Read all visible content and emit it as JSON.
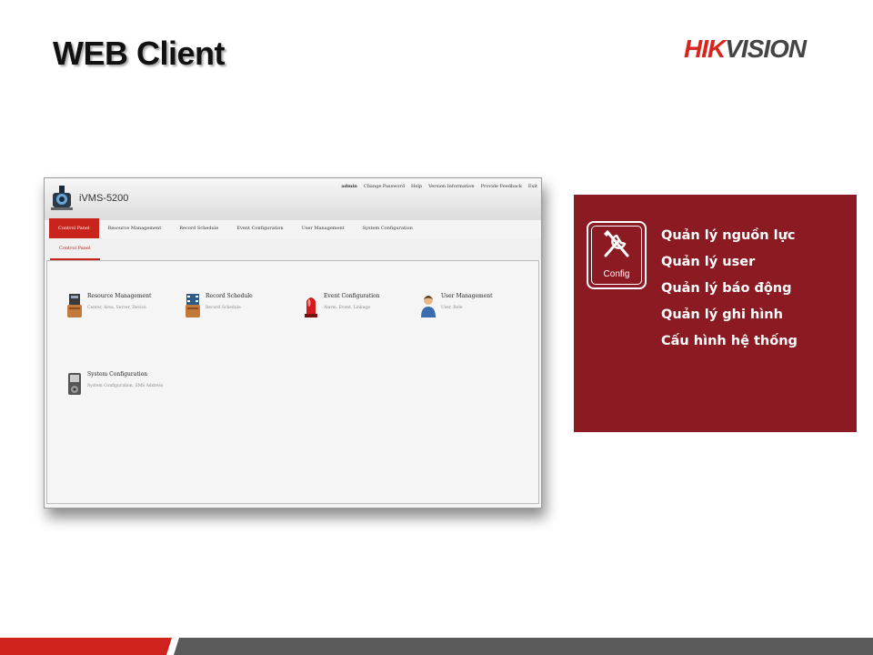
{
  "slide": {
    "title": "WEB Client",
    "brand_part1": "HIK",
    "brand_part2": "VISION"
  },
  "app": {
    "name": "iVMS-5200",
    "top_links": [
      "admin",
      "Change Password",
      "Help",
      "Version Information",
      "Provide Feedback",
      "Exit"
    ],
    "nav": [
      {
        "label": "Control Panel",
        "active": true
      },
      {
        "label": "Resource Management",
        "active": false
      },
      {
        "label": "Record Schedule",
        "active": false
      },
      {
        "label": "Event Configuration",
        "active": false
      },
      {
        "label": "User Management",
        "active": false
      },
      {
        "label": "System Configuration",
        "active": false
      }
    ],
    "sub_nav": "Control Panel",
    "modules": [
      {
        "title": "Resource Management",
        "subtitle": "Center, Area, Server, Device",
        "icon": "resource-icon"
      },
      {
        "title": "Record Schedule",
        "subtitle": "Record Schedule",
        "icon": "record-schedule-icon"
      },
      {
        "title": "Event Configuration",
        "subtitle": "Alarm, Event, Linkage",
        "icon": "alarm-light-icon"
      },
      {
        "title": "User Management",
        "subtitle": "User, Role",
        "icon": "user-icon"
      },
      {
        "title": "System Configuration",
        "subtitle": "System Configuration, SMS Address",
        "icon": "system-config-icon"
      }
    ]
  },
  "info_box": {
    "icon_label": "Config",
    "items": [
      "Quản lý nguồn lực",
      "Quản lý user",
      "Quản lý báo động",
      "Quản lý ghi hình",
      "Cấu hình hệ thống"
    ]
  },
  "colors": {
    "accent_red": "#c8231c",
    "info_box_bg": "#8c1a22",
    "bottom_bar_red": "#d0221d",
    "bottom_bar_gray": "#5a5a5a"
  }
}
